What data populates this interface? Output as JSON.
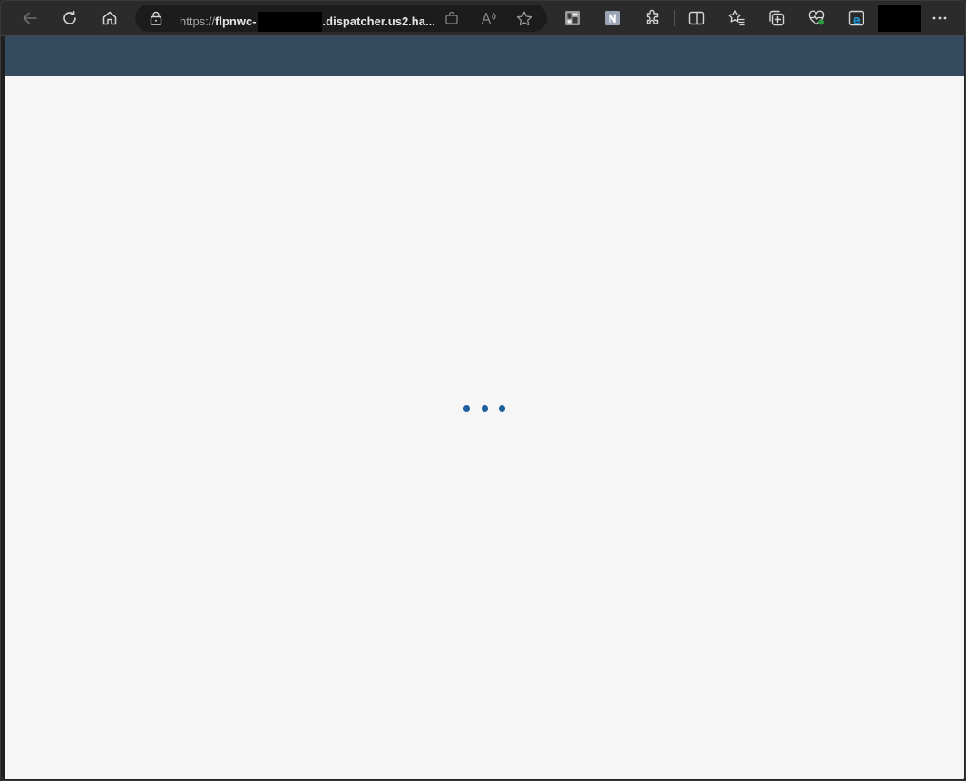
{
  "browser": {
    "address_bar": {
      "protocol": "https://",
      "host_prefix": "flpnwc-",
      "host_suffix": ".dispatcher.us2.ha..."
    },
    "toolbar_icons": [
      "back-arrow-icon",
      "refresh-icon",
      "home-icon",
      "lock-icon",
      "shopping-bag-icon",
      "read-aloud-icon",
      "favorite-star-icon",
      "extension-grid-icon",
      "notion-n-icon",
      "puzzle-extensions-icon",
      "split-screen-icon",
      "favorites-list-icon",
      "collections-icon",
      "browser-health-icon",
      "internet-explorer-mode-icon",
      "more-options-icon"
    ],
    "colors": {
      "toolbar_bg": "#2b2b2b",
      "app_header_bg": "#344a5e",
      "content_bg": "#f6f6f7",
      "loader_dot": "#1f5f9e"
    }
  },
  "page": {
    "state": "loading",
    "loader_dots": 3
  }
}
